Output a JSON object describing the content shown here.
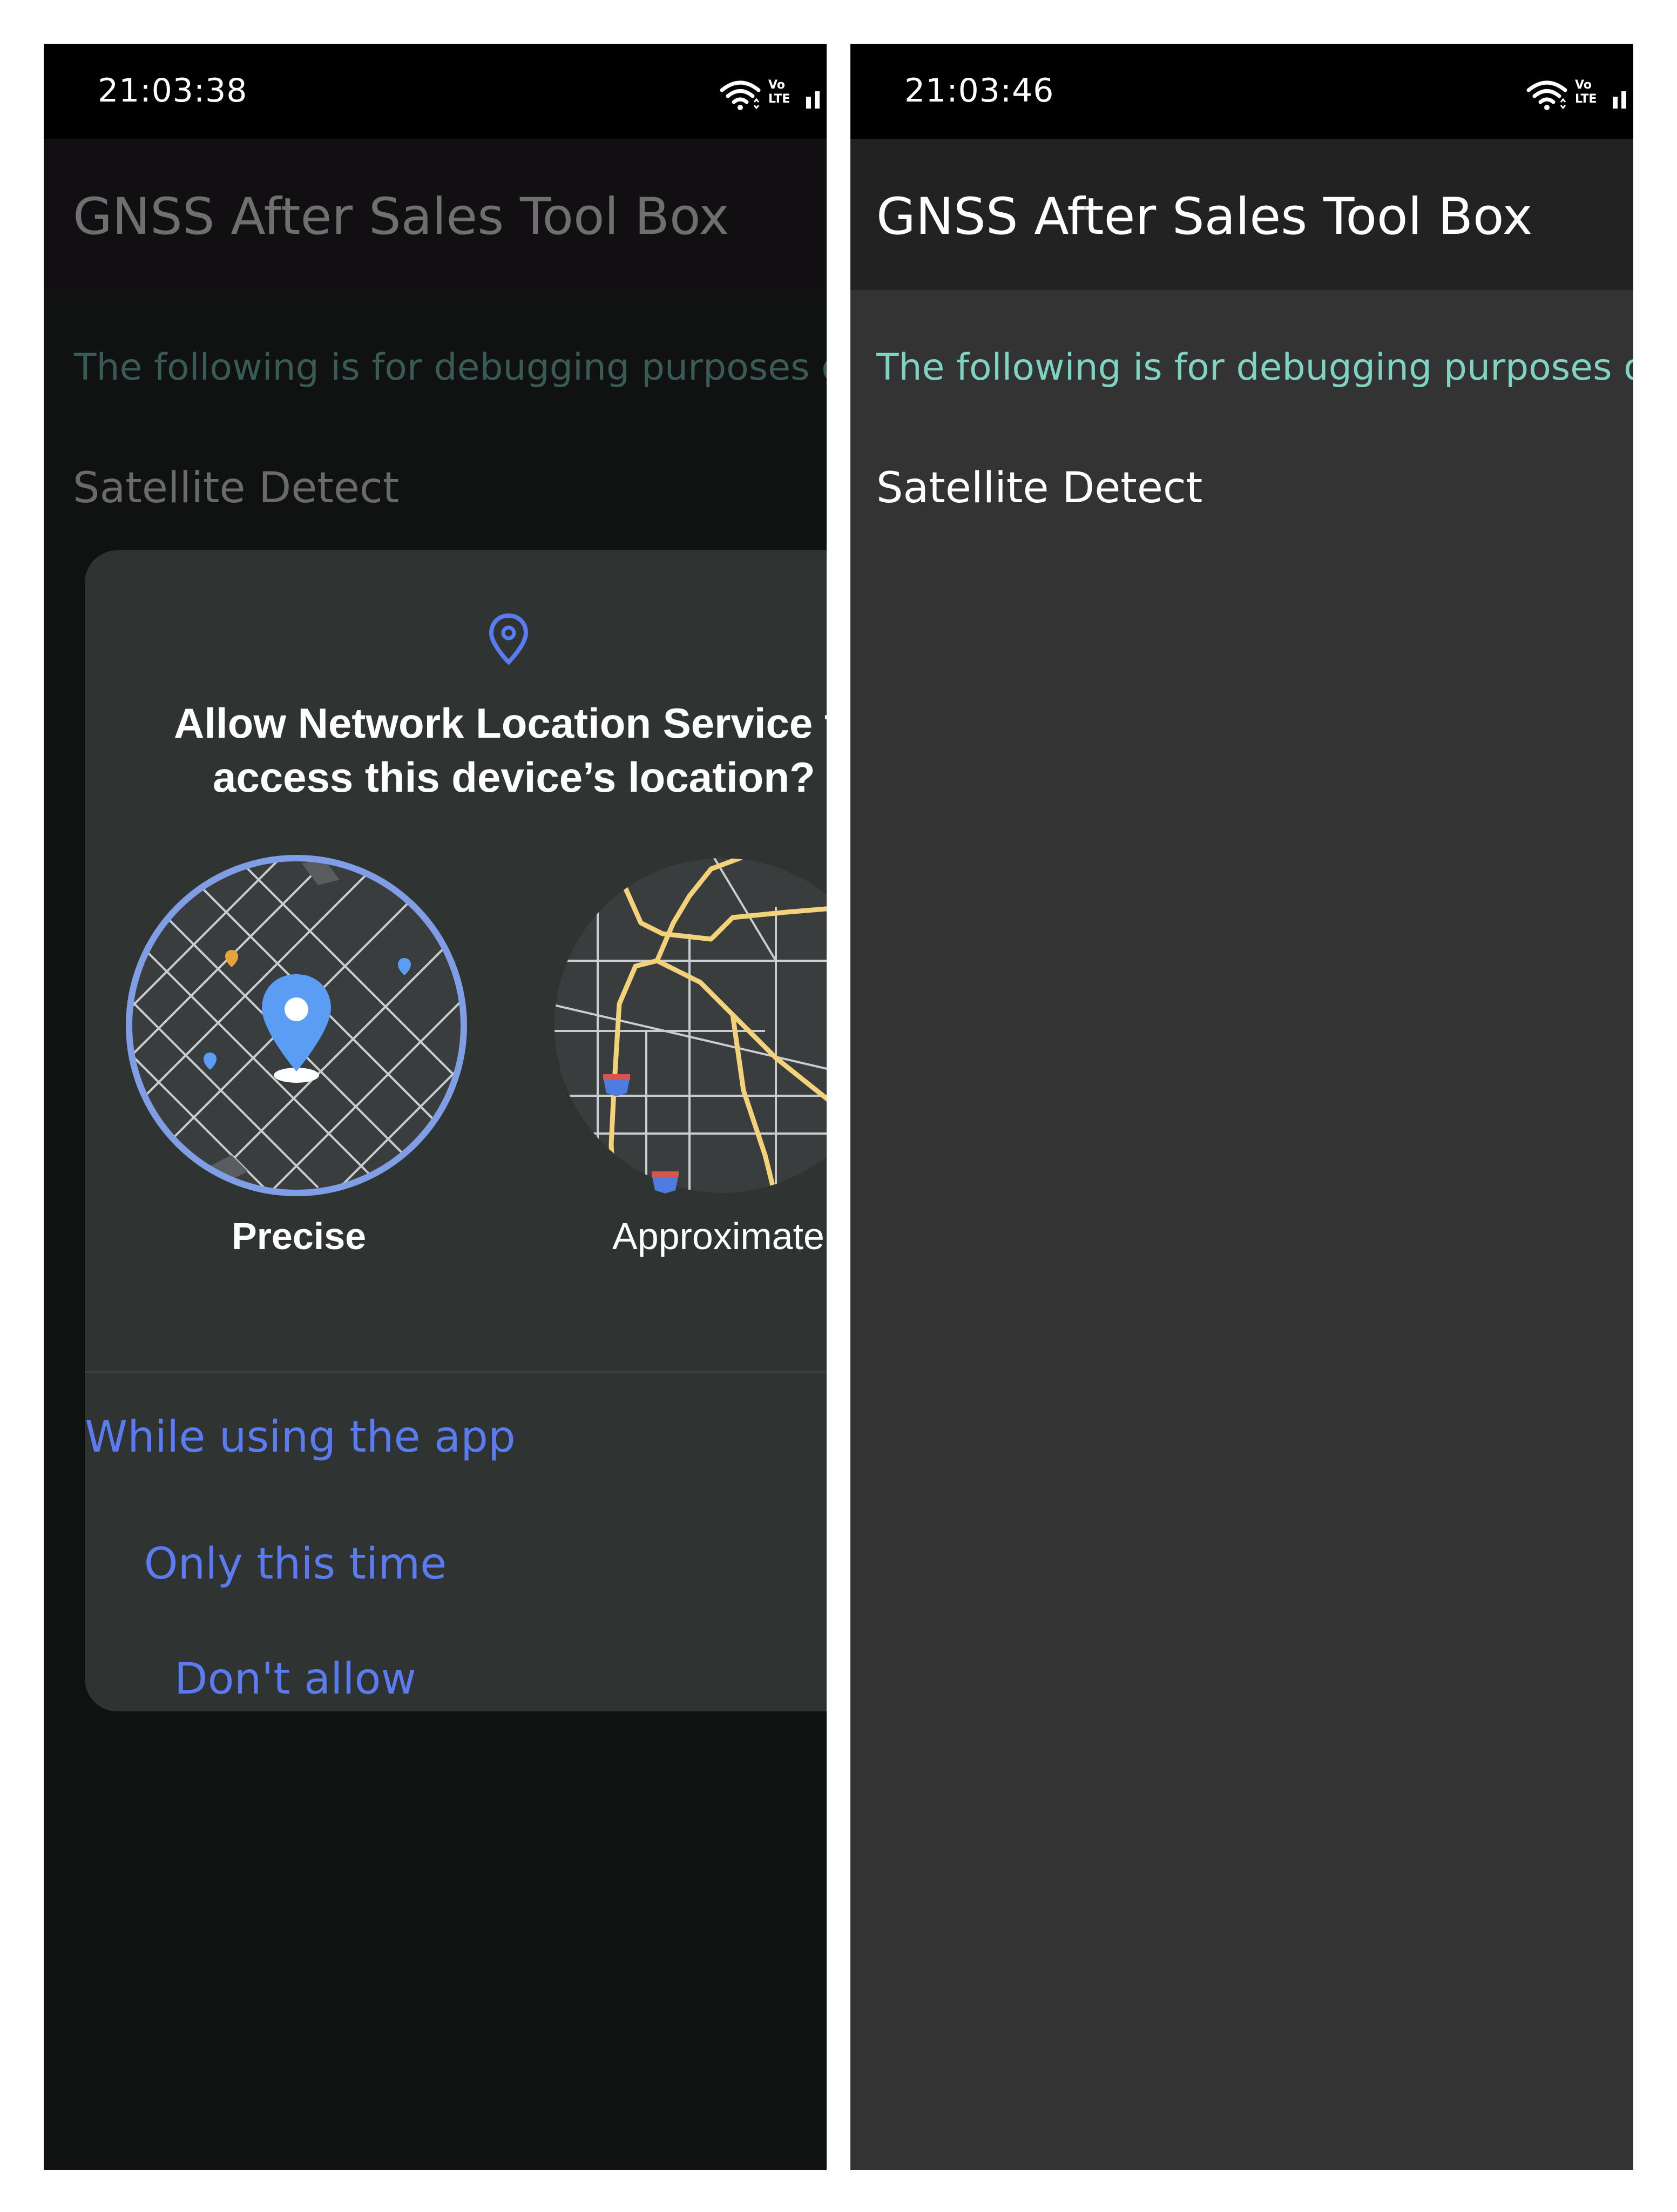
{
  "left_screen": {
    "status_time": "21:03:38",
    "app_title": "GNSS After Sales Tool Box",
    "debug_note": "The following is for debugging purposes on",
    "section_label": "Satellite Detect",
    "dialog": {
      "icon": "location-pin-icon",
      "title_line1": "Allow Network Location Service t",
      "title_line2": "access this device’s location?",
      "option_precise": "Precise",
      "option_approximate": "Approximate",
      "selected_option": "Precise",
      "button_while_using": "While using the app",
      "button_only_this_time": "Only this time",
      "button_dont_allow": "Don't allow"
    }
  },
  "right_screen": {
    "status_time": "21:03:46",
    "app_title": "GNSS After Sales Tool Box",
    "debug_note": "The following is for debugging purposes on",
    "section_label": "Satellite Detect"
  },
  "status_icons": [
    "wifi-icon",
    "volte-icon",
    "signal-icon"
  ],
  "colors": {
    "accent_blue": "#5b7bf0",
    "teal_text": "#7fd3c2",
    "dialog_bg": "#2f3331",
    "map_road_yellow": "#f4d27a"
  }
}
